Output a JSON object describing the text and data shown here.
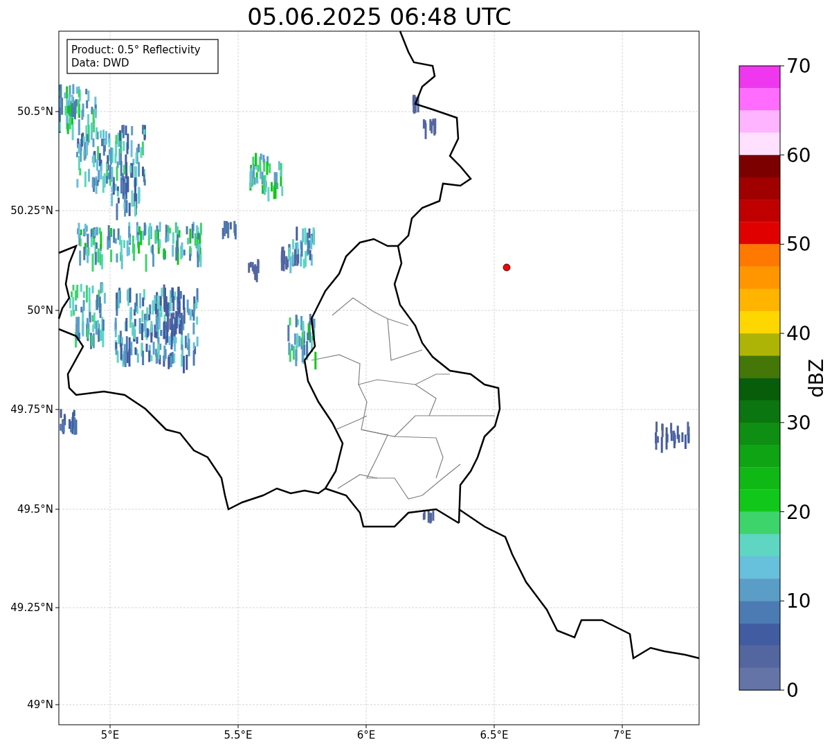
{
  "title": "05.06.2025 06:48 UTC",
  "legend": [
    "Product: 0.5° Reflectivity",
    "Data: DWD"
  ],
  "x_ticks": [
    "5°E",
    "5.5°E",
    "6°E",
    "6.5°E",
    "7°E"
  ],
  "y_ticks": [
    "50.5°N",
    "50.25°N",
    "50°N",
    "49.75°N",
    "49.5°N",
    "49.25°N",
    "49°N"
  ],
  "colorbar": {
    "label": "dBZ",
    "ticks": [
      "70",
      "60",
      "50",
      "40",
      "30",
      "20",
      "10",
      "0"
    ],
    "segments": [
      {
        "color": "#ee37ee"
      },
      {
        "color": "#ff6cff"
      },
      {
        "color": "#ffb4ff"
      },
      {
        "color": "#ffe0ff"
      },
      {
        "color": "#7c0000"
      },
      {
        "color": "#a00000"
      },
      {
        "color": "#c00000"
      },
      {
        "color": "#e00000"
      },
      {
        "color": "#ff7800"
      },
      {
        "color": "#ff9600"
      },
      {
        "color": "#ffb400"
      },
      {
        "color": "#fed700"
      },
      {
        "color": "#aeb406"
      },
      {
        "color": "#447708"
      },
      {
        "color": "#085d0b"
      },
      {
        "color": "#0b750f"
      },
      {
        "color": "#0e8e12"
      },
      {
        "color": "#0fa414"
      },
      {
        "color": "#10b816"
      },
      {
        "color": "#11c81a"
      },
      {
        "color": "#3ed46c"
      },
      {
        "color": "#5ed6c2"
      },
      {
        "color": "#67c0dc"
      },
      {
        "color": "#5a9dc6"
      },
      {
        "color": "#4c7bb3"
      },
      {
        "color": "#415ca0"
      },
      {
        "color": "#53669f"
      },
      {
        "color": "#6474a6"
      }
    ]
  }
}
